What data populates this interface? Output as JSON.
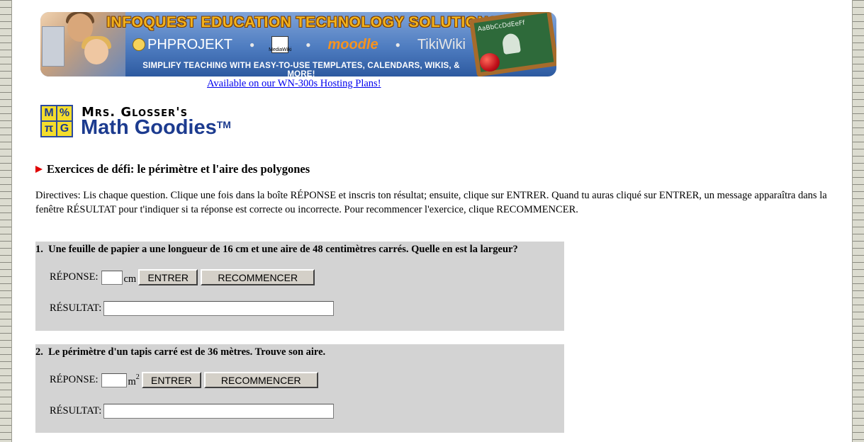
{
  "banner": {
    "title": "INFOQUEST EDUCATION TECHNOLOGY SOLUTIONS",
    "products": [
      "PHPROJEKT",
      "MediaWiki",
      "moodle",
      "TikiWiki"
    ],
    "tagline": "SIMPLIFY TEACHING WITH EASY-TO-USE TEMPLATES, CALENDARS, WIKIS, & MORE!",
    "chalkboard_text": "AaBbCcDdEeFf",
    "link_text": "Available on our WN-300s Hosting Plans!"
  },
  "logo": {
    "cells": [
      "M",
      "%",
      "π",
      "G"
    ],
    "line1": "Mrs. Glosser's",
    "line2": "Math Goodies",
    "trademark": "TM"
  },
  "page": {
    "heading": "Exercices de défi: le périmètre et l'aire des polygones",
    "directives": "Directives: Lis chaque question. Clique une fois dans la boîte RÉPONSE et inscris ton résultat; ensuite, clique sur ENTRER. Quand tu auras cliqué sur ENTRER, un message apparaîtra dans la fenêtre RÉSULTAT pour t'indiquer si ta réponse est correcte ou incorrecte. Pour recommencer l'exercice, clique RECOMMENCER."
  },
  "questions": [
    {
      "number": "1.",
      "text": "Une feuille de papier a une longueur de 16 cm et une aire de 48 centimètres carrés. Quelle en est la largeur?",
      "answer_label": "RÉPONSE:",
      "answer_value": "",
      "unit": "cm",
      "unit_sup": "",
      "enter_label": "ENTRER",
      "reset_label": "RECOMMENCER",
      "result_label": "RÉSULTAT:",
      "result_value": ""
    },
    {
      "number": "2.",
      "text": "Le périmètre d'un tapis carré est de 36 mètres. Trouve son aire.",
      "answer_label": "RÉPONSE:",
      "answer_value": "",
      "unit": "m",
      "unit_sup": "2",
      "enter_label": "ENTRER",
      "reset_label": "RECOMMENCER",
      "result_label": "RÉSULTAT:",
      "result_value": ""
    }
  ],
  "colors": {
    "question_bg": "#d3d3d3",
    "link": "#0000ee",
    "arrow": "#e00000",
    "logo_blue": "#1c3b8f"
  }
}
